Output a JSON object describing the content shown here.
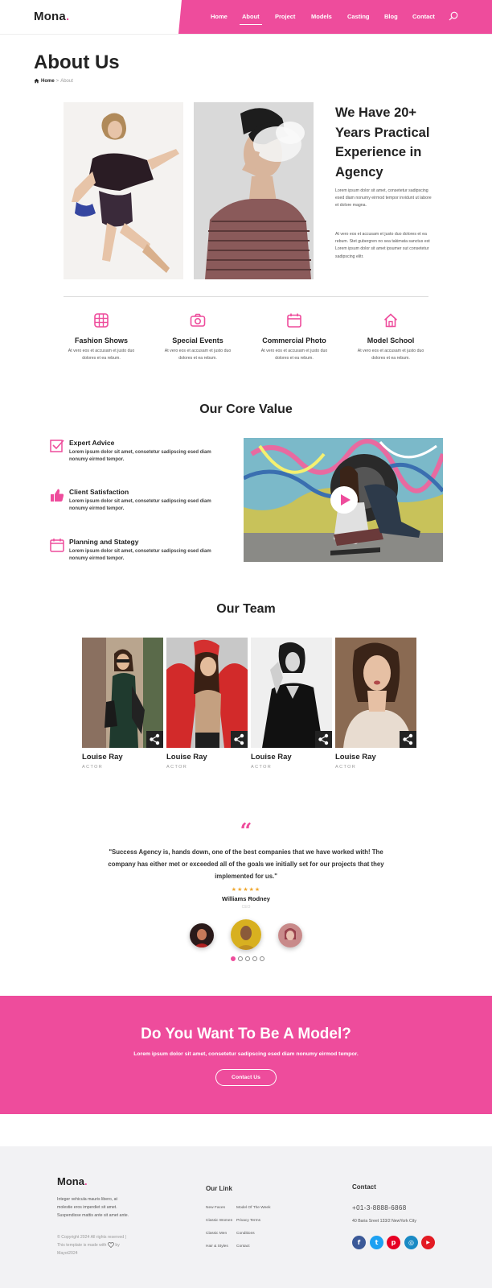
{
  "site": {
    "logo": "Mona",
    "logo_dot": "."
  },
  "nav": {
    "items": [
      "Home",
      "About",
      "Project",
      "Models",
      "Casting",
      "Blog",
      "Contact"
    ],
    "active": "About",
    "search_icon": "search-icon"
  },
  "page": {
    "title": "About Us",
    "breadcrumb": {
      "home": "Home",
      "separator": ">",
      "current": "About"
    }
  },
  "intro": {
    "heading": "We Have 20+ Years Practical Experience in Agency",
    "paragraph1": "Lorem ipsum dolor sit amet, consetetur sadipscing esed diam nonumy eirmod tempor invidunt ut labore et dolore magna.",
    "paragraph2": "At vero eos et accusam et justo duo dolores et ea rebum. Stet gubergren no sea takimata sanctus est Lorem ipsum dolor sit amet ipsumer sut consetetur sadipscing elitr."
  },
  "services": [
    {
      "icon": "grid-frame-icon",
      "title": "Fashion Shows",
      "desc": "At vero eos et accusam et justo duo dolores et ea rebum."
    },
    {
      "icon": "camera-icon",
      "title": "Special Events",
      "desc": "At vero eos et accusam et justo duo dolores et ea rebum."
    },
    {
      "icon": "calendar-icon",
      "title": "Commercial Photo",
      "desc": "At vero eos et accusam et justo duo dolores et ea rebum."
    },
    {
      "icon": "home-icon",
      "title": "Model School",
      "desc": "At vero eos et accusam et justo duo dolores et ea rebum."
    }
  ],
  "core": {
    "title": "Our Core Value",
    "items": [
      {
        "icon": "checkbox-icon",
        "title": "Expert Advice",
        "desc": "Lorem ipsum dolor sit amet, consetetur sadipscing esed diam nonumy eirmod tempor."
      },
      {
        "icon": "thumbs-up-icon",
        "title": "Client Satisfaction",
        "desc": "Lorem ipsum dolor sit amet, consetetur sadipscing esed diam nonumy eirmod tempor."
      },
      {
        "icon": "calendar-icon",
        "title": "Planning and Stategy",
        "desc": "Lorem ipsum dolor sit amet, consetetur sadipscing esed diam nonumy eirmod tempor."
      }
    ]
  },
  "team": {
    "title": "Our Team",
    "members": [
      {
        "name": "Louise Ray",
        "role": "ACTOR"
      },
      {
        "name": "Louise Ray",
        "role": "ACTOR"
      },
      {
        "name": "Louise Ray",
        "role": "ACTOR"
      },
      {
        "name": "Louise Ray",
        "role": "ACTOR"
      }
    ]
  },
  "testimonial": {
    "quote_mark": "“",
    "quote": "\"Success Agency is, hands down, one of the best companies that we have worked with! The company has either met or exceeded all of the goals we initially set for our projects that they implemented for us.\"",
    "stars": "★★★★★",
    "author": "Williams Rodney",
    "author_role": "CEO",
    "active_slide": 1,
    "slide_count": 5
  },
  "cta": {
    "title": "Do You Want To Be A Model?",
    "text": "Lorem ipsum dolor sit amet, consetetur sadipscing esed diam nonumy eirmod tempor.",
    "button": "Contact Us"
  },
  "footer": {
    "logo": "Mona",
    "logo_dot": ".",
    "about": "Integer vehicula mauris libero, at molestie eros imperdiet sit amet. Suspendisse mattis ante sit amet ante.",
    "copyright": "© Copyright 2024 All rights reserved | This template is made with",
    "credit": "by Mayot2024",
    "links_title": "Our Link",
    "links_col1": [
      "New Faces",
      "Classic Women",
      "Classic Men",
      "Hair & Styles"
    ],
    "links_col2": [
      "Model Of The Week",
      "Privacy Terms",
      "Conditions",
      "Contact"
    ],
    "contact_title": "Contact",
    "phone": "+01-3-8888-6868",
    "address": "40 Baria Sreet 133/2 NewYork City",
    "social": [
      {
        "icon": "facebook-icon",
        "glyph": "f",
        "color": "#3b5998"
      },
      {
        "icon": "twitter-icon",
        "glyph": "t",
        "color": "#1da1f2"
      },
      {
        "icon": "pinterest-icon",
        "glyph": "p",
        "color": "#e60023"
      },
      {
        "icon": "instagram-icon",
        "glyph": "◎",
        "color": "#1a8ac4"
      },
      {
        "icon": "youtube-icon",
        "glyph": "▶",
        "color": "#e31b23"
      }
    ]
  },
  "colors": {
    "accent": "#ee4c9c",
    "dark": "#222222",
    "footer_bg": "#f2f2f4"
  }
}
